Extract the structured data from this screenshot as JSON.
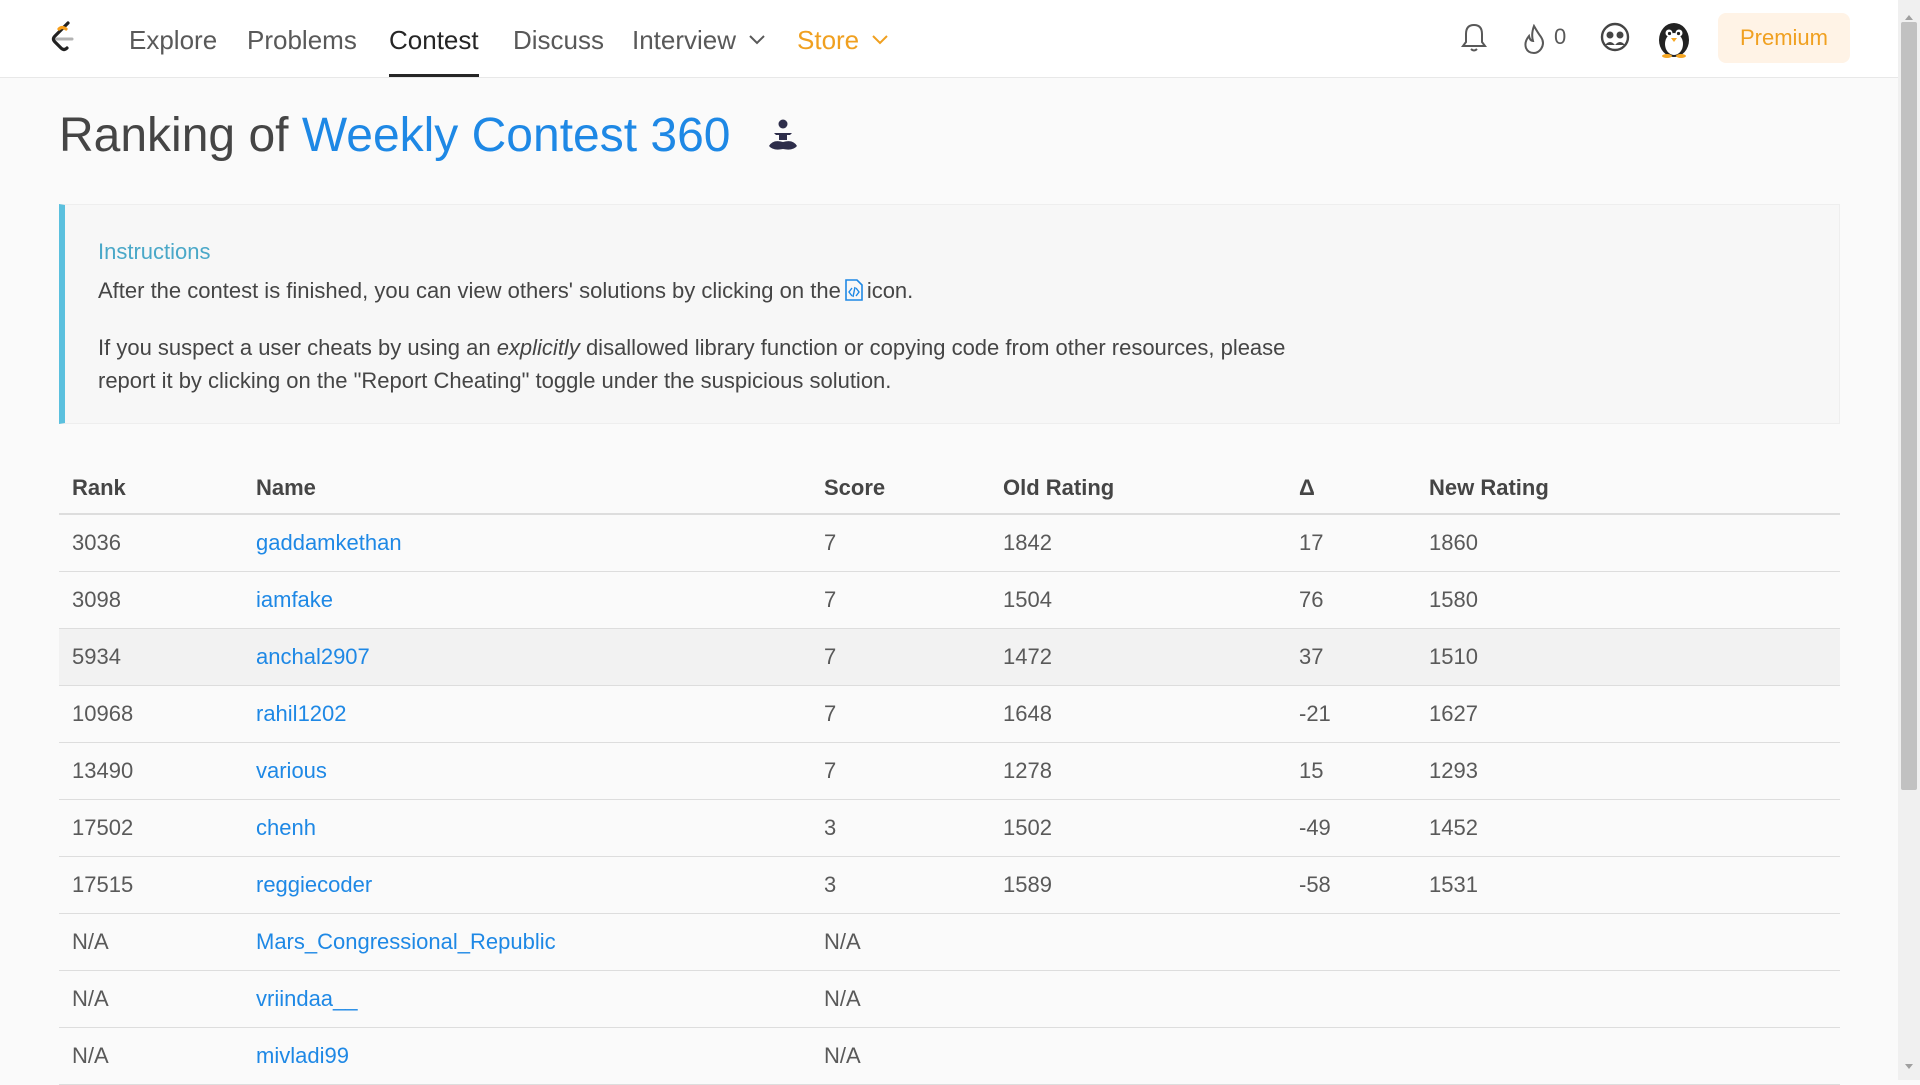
{
  "nav": {
    "items": [
      {
        "label": "Explore"
      },
      {
        "label": "Problems"
      },
      {
        "label": "Contest"
      },
      {
        "label": "Discuss"
      },
      {
        "label": "Interview"
      },
      {
        "label": "Store"
      }
    ],
    "active": "Contest",
    "streak_count": "0",
    "premium_label": "Premium",
    "icons": [
      "leetcode-logo",
      "bell-icon",
      "fire-icon",
      "group-icon",
      "avatar"
    ]
  },
  "title": {
    "prefix": "Ranking of ",
    "contest_name": "Weekly Contest 360"
  },
  "instructions": {
    "heading": "Instructions",
    "p1_before": "After the contest is finished, you can view others' solutions by clicking on the",
    "p1_after": "icon.",
    "p2_before": "If you suspect a user cheats by using an ",
    "p2_em": "explicitly",
    "p2_after": " disallowed library function or copying code from other resources, please report it by clicking on the \"Report Cheating\" toggle under the suspicious solution."
  },
  "table": {
    "headers": [
      "Rank",
      "Name",
      "Score",
      "Old Rating",
      "Δ",
      "New Rating"
    ],
    "rows": [
      {
        "rank": "3036",
        "name": "gaddamkethan",
        "score": "7",
        "old": "1842",
        "delta": "17",
        "new": "1860"
      },
      {
        "rank": "3098",
        "name": "iamfake",
        "score": "7",
        "old": "1504",
        "delta": "76",
        "new": "1580"
      },
      {
        "rank": "5934",
        "name": "anchal2907",
        "score": "7",
        "old": "1472",
        "delta": "37",
        "new": "1510"
      },
      {
        "rank": "10968",
        "name": "rahil1202",
        "score": "7",
        "old": "1648",
        "delta": "-21",
        "new": "1627"
      },
      {
        "rank": "13490",
        "name": "various",
        "score": "7",
        "old": "1278",
        "delta": "15",
        "new": "1293"
      },
      {
        "rank": "17502",
        "name": "chenh",
        "score": "3",
        "old": "1502",
        "delta": "-49",
        "new": "1452"
      },
      {
        "rank": "17515",
        "name": "reggiecoder",
        "score": "3",
        "old": "1589",
        "delta": "-58",
        "new": "1531"
      },
      {
        "rank": "N/A",
        "name": "Mars_Congressional_Republic",
        "score": "N/A",
        "old": "",
        "delta": "",
        "new": ""
      },
      {
        "rank": "N/A",
        "name": "vriindaa__",
        "score": "N/A",
        "old": "",
        "delta": "",
        "new": ""
      },
      {
        "rank": "N/A",
        "name": "mivladi99",
        "score": "N/A",
        "old": "",
        "delta": "",
        "new": ""
      }
    ]
  },
  "colors": {
    "accent": "#1e88e5",
    "store": "#f0a020",
    "instructions_border": "#5bc0de"
  }
}
